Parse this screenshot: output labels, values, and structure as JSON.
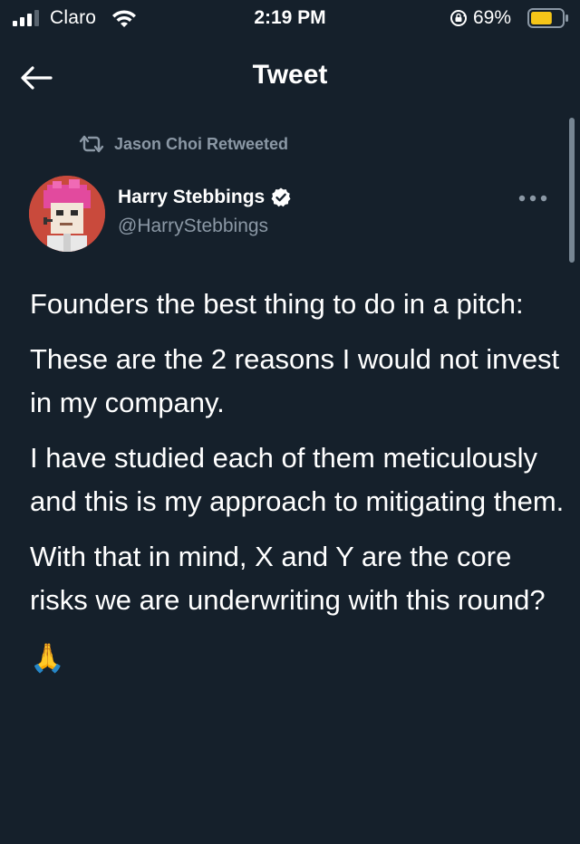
{
  "status_bar": {
    "carrier": "Claro",
    "time": "2:19 PM",
    "battery_percent": "69%",
    "battery_level": 0.69,
    "icons": [
      "signal-icon",
      "wifi-icon",
      "orientation-lock-icon",
      "battery-icon"
    ]
  },
  "header": {
    "title": "Tweet",
    "back_icon": "back-arrow-icon"
  },
  "tweet": {
    "retweet_context": "Jason Choi Retweeted",
    "author": {
      "name": "Harry Stebbings",
      "handle": "@HarryStebbings",
      "verified": true
    },
    "paragraphs": [
      "Founders the best thing to do in a pitch:",
      "These are the 2 reasons I would not invest in my company.",
      "I have studied each of them meticulously and this is my approach to mitigating them.",
      "With that in mind, X and Y are the core risks we are underwriting with this round?",
      "🙏"
    ]
  },
  "colors": {
    "background": "#15202b",
    "text": "#ffffff",
    "secondary_text": "#8b98a5",
    "verified_badge": "#ffffff",
    "battery_fill": "#f5c518"
  }
}
